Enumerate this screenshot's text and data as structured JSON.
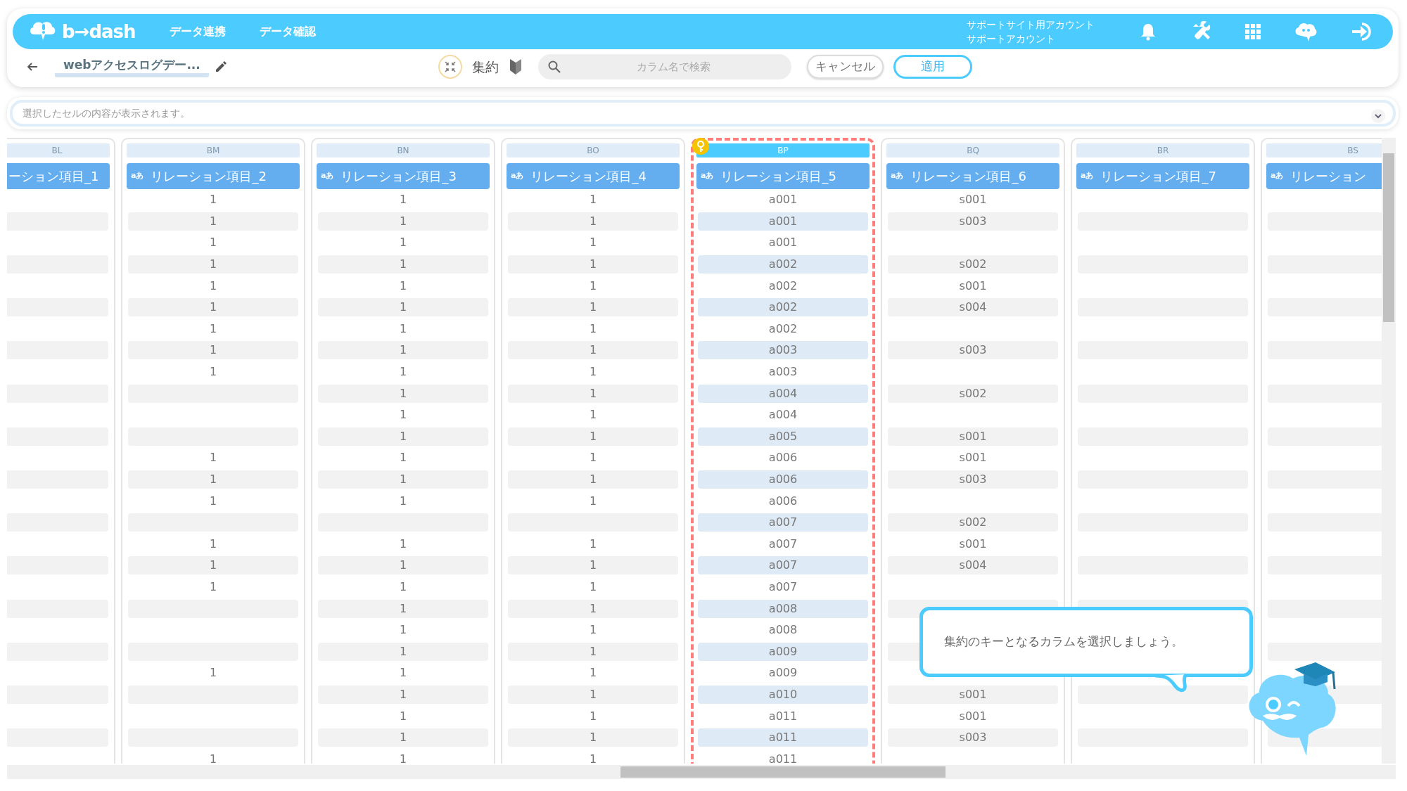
{
  "header": {
    "logo_text": "b→dash",
    "nav": [
      {
        "label": "データ連携"
      },
      {
        "label": "データ確認"
      }
    ],
    "account": [
      "サポートサイト用アカウント",
      "サポートアカウント"
    ]
  },
  "toolbar": {
    "title": "webアクセスログデー...",
    "mode_label": "集約",
    "search": {
      "placeholder": "カラム名で検索"
    },
    "cancel": "キャンセル",
    "apply": "適用"
  },
  "cell_viewer": {
    "placeholder": "選択したセルの内容が表示されます。"
  },
  "columns": [
    {
      "letter": "BL",
      "name": "ーション項目_1",
      "selected": false,
      "cells": [
        null,
        null,
        null,
        null,
        null,
        null,
        null,
        null,
        null,
        null,
        null,
        null,
        null,
        null,
        null,
        null,
        null,
        null,
        null,
        null,
        null,
        null,
        null,
        null,
        null,
        null,
        null
      ]
    },
    {
      "letter": "BM",
      "type": "aあ",
      "name": "リレーション項目_2",
      "selected": false,
      "cells": [
        "1",
        "1",
        "1",
        "1",
        "1",
        "1",
        "1",
        "1",
        "1",
        null,
        null,
        null,
        "1",
        "1",
        "1",
        null,
        "1",
        "1",
        "1",
        null,
        null,
        null,
        "1",
        null,
        null,
        null,
        "1"
      ]
    },
    {
      "letter": "BN",
      "type": "aあ",
      "name": "リレーション項目_3",
      "selected": false,
      "cells": [
        "1",
        "1",
        "1",
        "1",
        "1",
        "1",
        "1",
        "1",
        "1",
        "1",
        "1",
        "1",
        "1",
        "1",
        "1",
        null,
        "1",
        "1",
        "1",
        "1",
        "1",
        "1",
        "1",
        "1",
        "1",
        "1",
        "1"
      ]
    },
    {
      "letter": "BO",
      "type": "aあ",
      "name": "リレーション項目_4",
      "selected": false,
      "cells": [
        "1",
        "1",
        "1",
        "1",
        "1",
        "1",
        "1",
        "1",
        "1",
        "1",
        "1",
        "1",
        "1",
        "1",
        "1",
        null,
        "1",
        "1",
        "1",
        "1",
        "1",
        "1",
        "1",
        "1",
        "1",
        "1",
        "1"
      ]
    },
    {
      "letter": "BP",
      "type": "aあ",
      "name": "リレーション項目_5",
      "selected": true,
      "cells": [
        "a001",
        "a001",
        "a001",
        "a002",
        "a002",
        "a002",
        "a002",
        "a003",
        "a003",
        "a004",
        "a004",
        "a005",
        "a006",
        "a006",
        "a006",
        "a007",
        "a007",
        "a007",
        "a007",
        "a008",
        "a008",
        "a009",
        "a009",
        "a010",
        "a011",
        "a011",
        "a011"
      ]
    },
    {
      "letter": "BQ",
      "type": "aあ",
      "name": "リレーション項目_6",
      "selected": false,
      "cells": [
        "s001",
        "s003",
        null,
        "s002",
        "s001",
        "s004",
        null,
        "s003",
        null,
        "s002",
        null,
        "s001",
        "s001",
        "s003",
        null,
        "s002",
        "s001",
        "s004",
        null,
        null,
        null,
        null,
        null,
        "s001",
        "s001",
        "s003",
        null
      ]
    },
    {
      "letter": "BR",
      "type": "aあ",
      "name": "リレーション項目_7",
      "selected": false,
      "cells": [
        null,
        null,
        null,
        null,
        null,
        null,
        null,
        null,
        null,
        null,
        null,
        null,
        null,
        null,
        null,
        null,
        null,
        null,
        null,
        null,
        null,
        null,
        null,
        null,
        null,
        null,
        null
      ]
    },
    {
      "letter": "BS",
      "type": "aあ",
      "name": "リレーション",
      "selected": false,
      "cells": [
        null,
        null,
        null,
        null,
        null,
        null,
        null,
        null,
        null,
        null,
        null,
        null,
        null,
        null,
        null,
        null,
        null,
        null,
        null,
        null,
        null,
        null,
        null,
        null,
        null,
        null,
        null
      ]
    }
  ],
  "tooltip": "集約のキーとなるカラムを選択しましょう。"
}
